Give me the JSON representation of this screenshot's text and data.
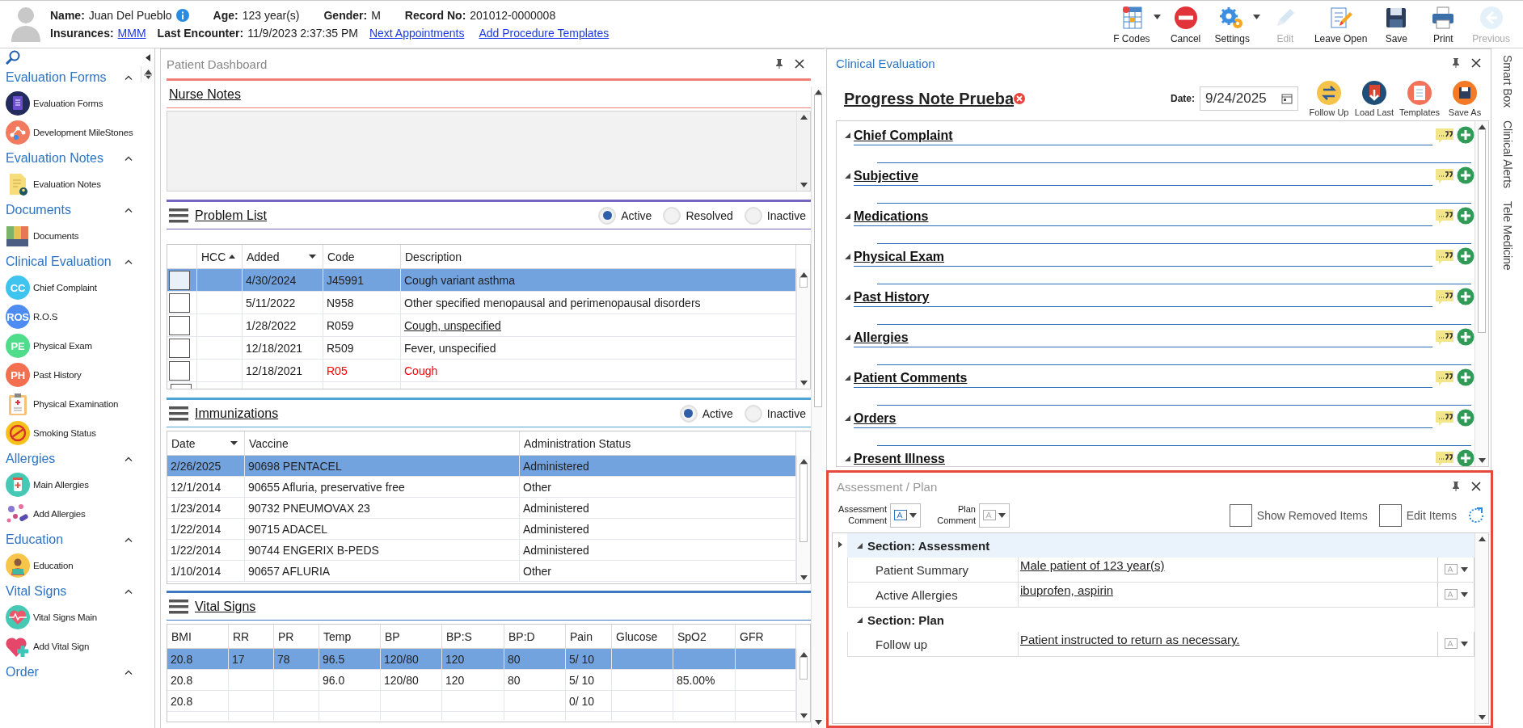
{
  "header": {
    "row_1": [
      {
        "label": "Name:",
        "value": "Juan Del Pueblo",
        "info": true
      },
      {
        "label": "Age:",
        "value": "123 year(s)",
        "info": false
      },
      {
        "label": "Gender:",
        "value": "M",
        "info": false
      },
      {
        "label": "Record No:",
        "value": "201012-0000008",
        "info": false
      }
    ],
    "row_2": [
      {
        "label": "Insurances:",
        "value": "MMM",
        "kind": "link"
      },
      {
        "label": "Last Encounter:",
        "value": "11/9/2023 2:37:35 PM",
        "kind": "text"
      }
    ],
    "links": [
      "Next Appointments",
      "Add Procedure Templates"
    ],
    "toolbar": [
      {
        "label": "F Codes",
        "menu": true,
        "disabled": false
      },
      {
        "label": "Cancel",
        "menu": false,
        "disabled": false
      },
      {
        "label": "Settings",
        "menu": true,
        "disabled": false
      },
      {
        "label": "Edit",
        "menu": false,
        "disabled": true
      },
      {
        "label": "Leave Open",
        "menu": false,
        "disabled": false
      },
      {
        "label": "Save",
        "menu": false,
        "disabled": false
      },
      {
        "label": "Print",
        "menu": false,
        "disabled": false
      },
      {
        "label": "Previous",
        "menu": false,
        "disabled": true
      }
    ]
  },
  "sidebar": {
    "sections": [
      {
        "title": "Evaluation Forms",
        "expanded": true,
        "items": [
          {
            "label": "Evaluation Forms"
          },
          {
            "label": "Development MileStones"
          }
        ]
      },
      {
        "title": "Evaluation Notes",
        "expanded": true,
        "items": [
          {
            "label": "Evaluation Notes"
          }
        ]
      },
      {
        "title": "Documents",
        "expanded": true,
        "items": [
          {
            "label": "Documents"
          }
        ]
      },
      {
        "title": "Clinical Evaluation",
        "expanded": true,
        "items": [
          {
            "label": "Chief Complaint",
            "badge": "CC"
          },
          {
            "label": "R.O.S",
            "badge": "ROS"
          },
          {
            "label": "Physical Exam",
            "badge": "PE"
          },
          {
            "label": "Past History",
            "badge": "PH"
          },
          {
            "label": "Physical Examination"
          },
          {
            "label": "Smoking Status"
          }
        ]
      },
      {
        "title": "Allergies",
        "expanded": true,
        "items": [
          {
            "label": "Main Allergies"
          },
          {
            "label": "Add Allergies"
          }
        ]
      },
      {
        "title": "Education",
        "expanded": true,
        "items": [
          {
            "label": "Education"
          }
        ]
      },
      {
        "title": "Vital Signs",
        "expanded": true,
        "items": [
          {
            "label": "Vital Signs Main"
          },
          {
            "label": "Add Vital Sign"
          }
        ]
      },
      {
        "title": "Order",
        "expanded": true
      }
    ]
  },
  "dashboard": {
    "title": "Patient Dashboard",
    "nurse_notes": {
      "title": "Nurse Notes"
    },
    "problem_list": {
      "title": "Problem List",
      "filters": [
        {
          "label": "Active",
          "selected": true
        },
        {
          "label": "Resolved",
          "selected": false
        },
        {
          "label": "Inactive",
          "selected": false
        }
      ],
      "columns": [
        {
          "label": "HCC",
          "sorted_up": true,
          "sorted_down": false
        },
        {
          "label": "Added",
          "sorted_up": false,
          "sorted_down": true
        },
        {
          "label": "Code",
          "sorted_up": false,
          "sorted_down": false
        },
        {
          "label": "Description",
          "sorted_up": false,
          "sorted_down": false
        }
      ],
      "rows": [
        {
          "added": "4/30/2024",
          "code": "J45991",
          "description": "Cough variant asthma",
          "selected": true,
          "checked": false,
          "linked": false
        },
        {
          "added": "5/11/2022",
          "code": "N958",
          "description": "Other specified menopausal and perimenopausal disorders",
          "selected": false,
          "checked": false,
          "linked": false
        },
        {
          "added": "1/28/2022",
          "code": "R059",
          "description": "Cough, unspecified",
          "selected": false,
          "checked": false,
          "linked": true
        },
        {
          "added": "12/18/2021",
          "code": "R509",
          "description": "Fever, unspecified",
          "selected": false,
          "checked": false,
          "linked": false
        },
        {
          "added": "12/18/2021",
          "code": "R05",
          "description": "Cough",
          "selected": false,
          "checked": false,
          "linked": false,
          "color": "#ff0000"
        }
      ]
    },
    "immunizations": {
      "title": "Immunizations",
      "filters": [
        {
          "label": "Active",
          "selected": true
        },
        {
          "label": "Inactive",
          "selected": false
        }
      ],
      "columns": [
        {
          "label": "Date",
          "sorted_up": false,
          "sorted_down": true
        },
        {
          "label": "Vaccine",
          "sorted_up": false,
          "sorted_down": false
        },
        {
          "label": "Administration Status",
          "sorted_up": false,
          "sorted_down": false
        }
      ],
      "rows": [
        {
          "cells": [
            "2/26/2025",
            "90698 PENTACEL",
            "Administered"
          ],
          "selected": true
        },
        {
          "cells": [
            "12/1/2014",
            "90655 Afluria, preservative free",
            "Other"
          ],
          "selected": false
        },
        {
          "cells": [
            "1/23/2014",
            "90732 PNEUMOVAX 23",
            "Administered"
          ],
          "selected": false
        },
        {
          "cells": [
            "1/22/2014",
            "90715 ADACEL",
            "Administered"
          ],
          "selected": false
        },
        {
          "cells": [
            "1/22/2014",
            "90744 ENGERIX B-PEDS",
            "Administered"
          ],
          "selected": false
        },
        {
          "cells": [
            "1/10/2014",
            "90657 AFLURIA",
            "Other"
          ],
          "selected": false
        }
      ]
    },
    "vital_signs": {
      "title": "Vital Signs",
      "columns": [
        "BMI",
        "RR",
        "PR",
        "Temp",
        "BP",
        "BP:S",
        "BP:D",
        "Pain",
        "Glucose",
        "SpO2",
        "GFR"
      ],
      "rows": [
        {
          "cells": [
            "20.8",
            "17",
            "78",
            "96.5",
            "120/80",
            "120",
            "80",
            "5/ 10",
            null,
            null,
            null
          ],
          "selected": true
        },
        {
          "cells": [
            "20.8",
            null,
            null,
            "96.0",
            "120/80",
            "120",
            "80",
            "5/ 10",
            null,
            "85.00%",
            null
          ],
          "selected": false
        },
        {
          "cells": [
            "20.8",
            null,
            null,
            null,
            null,
            null,
            null,
            "0/ 10",
            null,
            null,
            null
          ],
          "selected": false
        }
      ]
    }
  },
  "clinical_evaluation": {
    "title": "Clinical Evaluation",
    "note_title": "Progress Note Prueba",
    "date_label": "Date:",
    "date": "9/24/2025",
    "actions": [
      {
        "label": "Follow Up"
      },
      {
        "label": "Load Last"
      },
      {
        "label": "Templates"
      },
      {
        "label": "Save As"
      }
    ],
    "sections": [
      {
        "title": "Chief Complaint",
        "expanded": true
      },
      {
        "title": "Subjective",
        "expanded": true
      },
      {
        "title": "Medications",
        "expanded": true
      },
      {
        "title": "Physical Exam",
        "expanded": true
      },
      {
        "title": "Past History",
        "expanded": true
      },
      {
        "title": "Allergies",
        "expanded": true
      },
      {
        "title": "Patient Comments",
        "expanded": true
      },
      {
        "title": "Orders",
        "expanded": true
      },
      {
        "title": "Present Illness",
        "expanded": true
      }
    ]
  },
  "assessment_plan": {
    "title": "Assessment / Plan",
    "comment_pickers": [
      {
        "label": "Assessment Comment",
        "disabled": false
      },
      {
        "label": "Plan Comment",
        "disabled": true
      }
    ],
    "options": [
      {
        "label": "Show Removed Items",
        "checked": false
      },
      {
        "label": "Edit Items",
        "checked": false
      }
    ],
    "groups": [
      {
        "title": "Section: Assessment",
        "expanded": true,
        "selected": true,
        "fields": [
          {
            "label": "Patient Summary",
            "value": "Male patient of 123 year(s)"
          },
          {
            "label": "Active Allergies",
            "value": "ibuprofen, aspirin"
          }
        ]
      },
      {
        "title": "Section: Plan",
        "expanded": true,
        "selected": false,
        "fields": [
          {
            "label": "Follow up",
            "value": "Patient instructed to return as necessary."
          }
        ]
      }
    ]
  },
  "side_tabs": [
    "Smart Box",
    "Clinical Alerts",
    "Tele Medicine"
  ]
}
